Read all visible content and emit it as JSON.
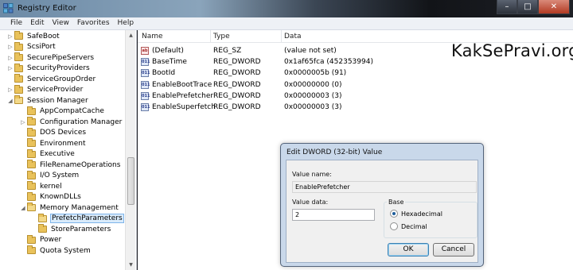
{
  "window": {
    "title": "Registry Editor",
    "buttons": {
      "minimize": "–",
      "maximize": "□",
      "close": "✕"
    }
  },
  "menu": [
    "File",
    "Edit",
    "View",
    "Favorites",
    "Help"
  ],
  "tree": {
    "items": [
      {
        "label": "SafeBoot",
        "level": 1,
        "expander": "▷",
        "state": "closed"
      },
      {
        "label": "ScsiPort",
        "level": 1,
        "expander": "▷",
        "state": "closed"
      },
      {
        "label": "SecurePipeServers",
        "level": 1,
        "expander": "▷",
        "state": "closed"
      },
      {
        "label": "SecurityProviders",
        "level": 1,
        "expander": "▷",
        "state": "closed"
      },
      {
        "label": "ServiceGroupOrder",
        "level": 1,
        "expander": "",
        "state": "closed"
      },
      {
        "label": "ServiceProvider",
        "level": 1,
        "expander": "▷",
        "state": "closed"
      },
      {
        "label": "Session Manager",
        "level": 1,
        "expander": "◢",
        "state": "open"
      },
      {
        "label": "AppCompatCache",
        "level": 2,
        "expander": "",
        "state": "closed"
      },
      {
        "label": "Configuration Manager",
        "level": 2,
        "expander": "▷",
        "state": "closed"
      },
      {
        "label": "DOS Devices",
        "level": 2,
        "expander": "",
        "state": "closed"
      },
      {
        "label": "Environment",
        "level": 2,
        "expander": "",
        "state": "closed"
      },
      {
        "label": "Executive",
        "level": 2,
        "expander": "",
        "state": "closed"
      },
      {
        "label": "FileRenameOperations",
        "level": 2,
        "expander": "",
        "state": "closed"
      },
      {
        "label": "I/O System",
        "level": 2,
        "expander": "",
        "state": "closed"
      },
      {
        "label": "kernel",
        "level": 2,
        "expander": "",
        "state": "closed"
      },
      {
        "label": "KnownDLLs",
        "level": 2,
        "expander": "",
        "state": "closed"
      },
      {
        "label": "Memory Management",
        "level": 2,
        "expander": "◢",
        "state": "open"
      },
      {
        "label": "PrefetchParameters",
        "level": 3,
        "expander": "",
        "state": "open",
        "selected": true
      },
      {
        "label": "StoreParameters",
        "level": 3,
        "expander": "",
        "state": "closed"
      },
      {
        "label": "Power",
        "level": 2,
        "expander": "",
        "state": "closed"
      },
      {
        "label": "Quota System",
        "level": 2,
        "expander": "",
        "state": "closed"
      }
    ],
    "scroll_arrows": {
      "up": "▲",
      "down": "▼"
    }
  },
  "list": {
    "columns": [
      "Name",
      "Type",
      "Data"
    ],
    "rows": [
      {
        "name": "(Default)",
        "type": "REG_SZ",
        "data": "(value not set)",
        "icon": "ab",
        "kind": "sz"
      },
      {
        "name": "BaseTime",
        "type": "REG_DWORD",
        "data": "0x1af65fca (452353994)",
        "icon": "011",
        "kind": "dword"
      },
      {
        "name": "BootId",
        "type": "REG_DWORD",
        "data": "0x0000005b (91)",
        "icon": "011",
        "kind": "dword"
      },
      {
        "name": "EnableBootTrace",
        "type": "REG_DWORD",
        "data": "0x00000000 (0)",
        "icon": "011",
        "kind": "dword"
      },
      {
        "name": "EnablePrefetcher",
        "type": "REG_DWORD",
        "data": "0x00000003 (3)",
        "icon": "011",
        "kind": "dword"
      },
      {
        "name": "EnableSuperfetch",
        "type": "REG_DWORD",
        "data": "0x00000003 (3)",
        "icon": "011",
        "kind": "dword"
      }
    ]
  },
  "watermark": "KakSePravi.org",
  "dialog": {
    "title": "Edit DWORD (32-bit) Value",
    "value_name_label": "Value name:",
    "value_name": "EnablePrefetcher",
    "value_data_label": "Value data:",
    "value_data": "2",
    "base_label": "Base",
    "base_options": [
      {
        "label": "Hexadecimal",
        "selected": true
      },
      {
        "label": "Decimal",
        "selected": false
      }
    ],
    "ok_label": "OK",
    "cancel_label": "Cancel"
  }
}
